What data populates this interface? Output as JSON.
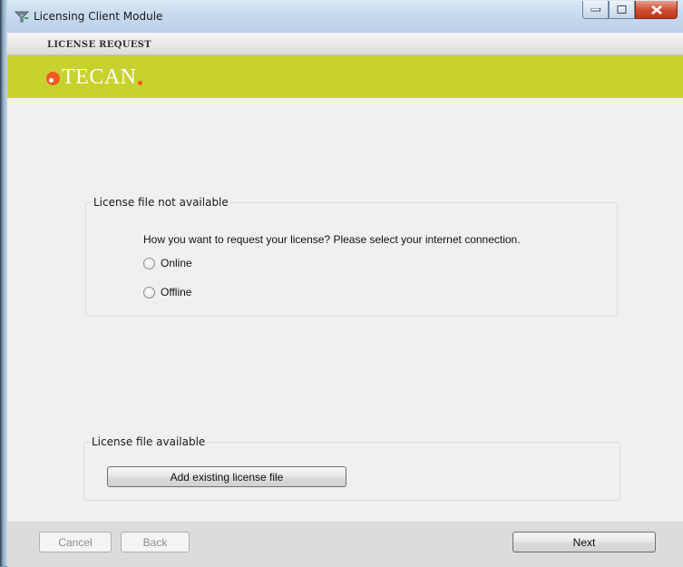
{
  "window": {
    "title": "Licensing Client Module"
  },
  "header": {
    "title": "LICENSE REQUEST",
    "brand": "TECAN",
    "brand_color": "#c7d22e",
    "accent": "#f25a22"
  },
  "not_available": {
    "legend": "License file not available",
    "question": "How you want to request your license? Please select your internet connection.",
    "options": [
      {
        "label": "Online",
        "checked": false
      },
      {
        "label": "Offline",
        "checked": false
      }
    ]
  },
  "available": {
    "legend": "License file available",
    "add_button": "Add existing license file"
  },
  "footer": {
    "cancel": "Cancel",
    "back": "Back",
    "next": "Next"
  }
}
